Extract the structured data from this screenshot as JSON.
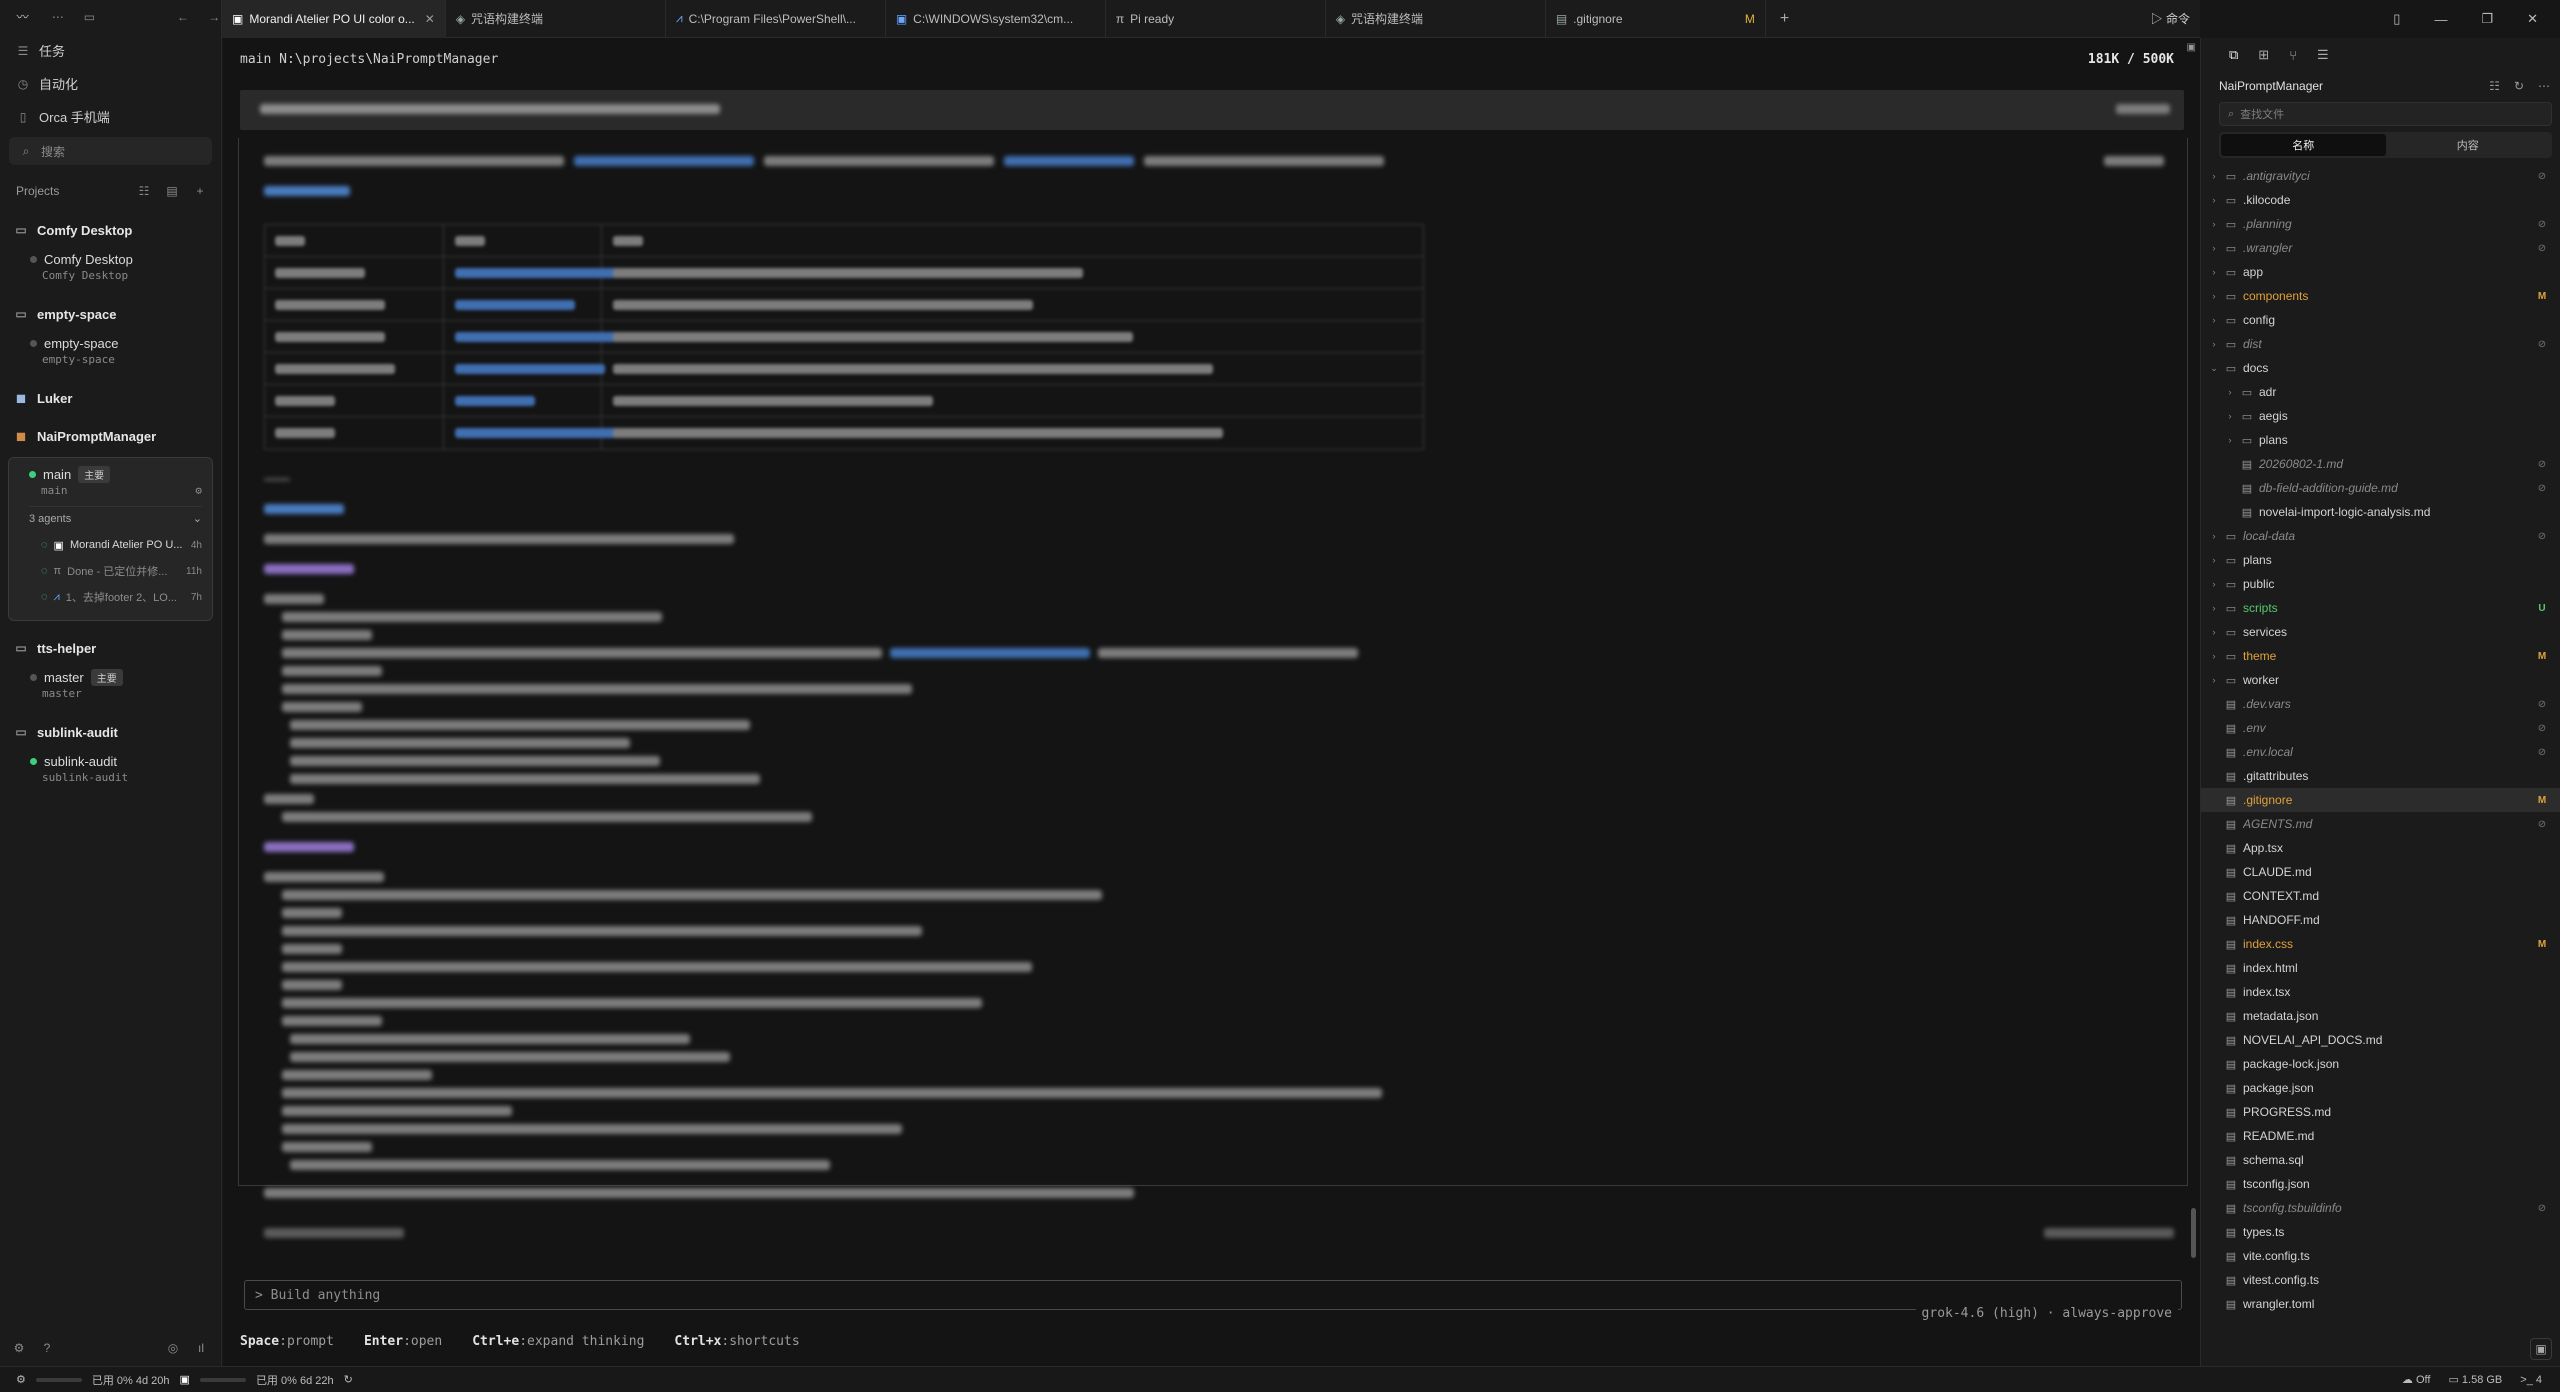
{
  "sidebar": {
    "nav": [
      {
        "label": "任务",
        "icon": "tasks-icon"
      },
      {
        "label": "自动化",
        "icon": "automation-icon"
      },
      {
        "label": "Orca 手机端",
        "icon": "phone-icon"
      }
    ],
    "search_placeholder": "搜索",
    "projects_label": "Projects",
    "groups": [
      {
        "name": "Comfy Desktop",
        "worktrees": [
          {
            "name": "Comfy Desktop",
            "branch": "Comfy Desktop"
          }
        ]
      },
      {
        "name": "empty-space",
        "worktrees": [
          {
            "name": "empty-space",
            "branch": "empty-space"
          }
        ]
      },
      {
        "name": "Luker",
        "worktrees": []
      },
      {
        "name": "NaiPromptManager",
        "worktrees": []
      },
      {
        "name": "tts-helper",
        "worktrees": [
          {
            "name": "master",
            "badge": "主要",
            "branch": "master"
          }
        ]
      },
      {
        "name": "sublink-audit",
        "worktrees": [
          {
            "name": "sublink-audit",
            "branch": "sublink-audit"
          }
        ]
      }
    ],
    "active_worktree": {
      "name": "main",
      "badge": "主要",
      "branch": "main",
      "agents_label": "3 agents",
      "agents": [
        {
          "title": "Morandi Atelier PO U...",
          "age": "4h"
        },
        {
          "title": "Done - 已定位并修...",
          "age": "11h"
        },
        {
          "title": "1、去掉footer 2、LO...",
          "age": "7h"
        }
      ]
    }
  },
  "tabs": [
    {
      "label": "Morandi Atelier PO UI color o..."
    },
    {
      "label": "咒语构建终端"
    },
    {
      "label": "C:\\Program Files\\PowerShell\\..."
    },
    {
      "label": "C:\\WINDOWS\\system32\\cm..."
    },
    {
      "label": "Pi ready"
    },
    {
      "label": "咒语构建终端"
    },
    {
      "label": ".gitignore",
      "status": "M"
    }
  ],
  "tab_run_label": "命令",
  "terminal": {
    "path": "main N:\\projects\\NaiPromptManager",
    "context": "181K / 500K",
    "input_placeholder": "> Build anything",
    "model": "grok-4.6 (high) · always-approve",
    "hints": [
      {
        "key": "Space",
        "action": ":prompt"
      },
      {
        "key": "Enter",
        "action": ":open"
      },
      {
        "key": "Ctrl+e",
        "action": ":expand thinking"
      },
      {
        "key": "Ctrl+x",
        "action": ":shortcuts"
      }
    ]
  },
  "files": {
    "title": "NaiPromptManager",
    "search_placeholder": "查找文件",
    "seg_name": "名称",
    "seg_content": "内容",
    "tree": [
      {
        "name": ".antigravityci",
        "kind": "folder",
        "depth": 0,
        "state": "ignored",
        "status": "o"
      },
      {
        "name": ".kilocode",
        "kind": "folder",
        "depth": 0,
        "state": "",
        "status": ""
      },
      {
        "name": ".planning",
        "kind": "folder",
        "depth": 0,
        "state": "ignored",
        "status": "o"
      },
      {
        "name": ".wrangler",
        "kind": "folder",
        "depth": 0,
        "state": "ignored",
        "status": "o"
      },
      {
        "name": "app",
        "kind": "folder",
        "depth": 0,
        "state": "",
        "status": ""
      },
      {
        "name": "components",
        "kind": "folder",
        "depth": 0,
        "state": "modified",
        "status": "M"
      },
      {
        "name": "config",
        "kind": "folder",
        "depth": 0,
        "state": "",
        "status": ""
      },
      {
        "name": "dist",
        "kind": "folder",
        "depth": 0,
        "state": "ignored",
        "status": "o"
      },
      {
        "name": "docs",
        "kind": "folder-open",
        "depth": 0,
        "state": "",
        "status": ""
      },
      {
        "name": "adr",
        "kind": "folder",
        "depth": 1,
        "state": "",
        "status": ""
      },
      {
        "name": "aegis",
        "kind": "folder",
        "depth": 1,
        "state": "",
        "status": ""
      },
      {
        "name": "plans",
        "kind": "folder",
        "depth": 1,
        "state": "",
        "status": ""
      },
      {
        "name": "20260802-1.md",
        "kind": "file",
        "depth": 1,
        "state": "ignored",
        "status": "o"
      },
      {
        "name": "db-field-addition-guide.md",
        "kind": "file",
        "depth": 1,
        "state": "ignored",
        "status": "o"
      },
      {
        "name": "novelai-import-logic-analysis.md",
        "kind": "file",
        "depth": 1,
        "state": "",
        "status": ""
      },
      {
        "name": "local-data",
        "kind": "folder",
        "depth": 0,
        "state": "ignored",
        "status": "o"
      },
      {
        "name": "plans",
        "kind": "folder",
        "depth": 0,
        "state": "",
        "status": ""
      },
      {
        "name": "public",
        "kind": "folder",
        "depth": 0,
        "state": "",
        "status": ""
      },
      {
        "name": "scripts",
        "kind": "folder",
        "depth": 0,
        "state": "new",
        "status": "U"
      },
      {
        "name": "services",
        "kind": "folder",
        "depth": 0,
        "state": "",
        "status": ""
      },
      {
        "name": "theme",
        "kind": "folder",
        "depth": 0,
        "state": "modified",
        "status": "M"
      },
      {
        "name": "worker",
        "kind": "folder",
        "depth": 0,
        "state": "",
        "status": ""
      },
      {
        "name": ".dev.vars",
        "kind": "file",
        "depth": 0,
        "state": "ignored",
        "status": "o"
      },
      {
        "name": ".env",
        "kind": "file",
        "depth": 0,
        "state": "ignored",
        "status": "o"
      },
      {
        "name": ".env.local",
        "kind": "file",
        "depth": 0,
        "state": "ignored",
        "status": "o"
      },
      {
        "name": ".gitattributes",
        "kind": "file",
        "depth": 0,
        "state": "",
        "status": ""
      },
      {
        "name": ".gitignore",
        "kind": "file",
        "depth": 0,
        "state": "modified",
        "status": "M",
        "selected": true
      },
      {
        "name": "AGENTS.md",
        "kind": "file",
        "depth": 0,
        "state": "ignored",
        "status": "o"
      },
      {
        "name": "App.tsx",
        "kind": "file",
        "depth": 0,
        "state": "",
        "status": ""
      },
      {
        "name": "CLAUDE.md",
        "kind": "file",
        "depth": 0,
        "state": "",
        "status": ""
      },
      {
        "name": "CONTEXT.md",
        "kind": "file",
        "depth": 0,
        "state": "",
        "status": ""
      },
      {
        "name": "HANDOFF.md",
        "kind": "file",
        "depth": 0,
        "state": "",
        "status": ""
      },
      {
        "name": "index.css",
        "kind": "file",
        "depth": 0,
        "state": "modified",
        "status": "M"
      },
      {
        "name": "index.html",
        "kind": "file",
        "depth": 0,
        "state": "",
        "status": ""
      },
      {
        "name": "index.tsx",
        "kind": "file",
        "depth": 0,
        "state": "",
        "status": ""
      },
      {
        "name": "metadata.json",
        "kind": "file",
        "depth": 0,
        "state": "",
        "status": ""
      },
      {
        "name": "NOVELAI_API_DOCS.md",
        "kind": "file",
        "depth": 0,
        "state": "",
        "status": ""
      },
      {
        "name": "package-lock.json",
        "kind": "file",
        "depth": 0,
        "state": "",
        "status": ""
      },
      {
        "name": "package.json",
        "kind": "file",
        "depth": 0,
        "state": "",
        "status": ""
      },
      {
        "name": "PROGRESS.md",
        "kind": "file",
        "depth": 0,
        "state": "",
        "status": ""
      },
      {
        "name": "README.md",
        "kind": "file",
        "depth": 0,
        "state": "",
        "status": ""
      },
      {
        "name": "schema.sql",
        "kind": "file",
        "depth": 0,
        "state": "",
        "status": ""
      },
      {
        "name": "tsconfig.json",
        "kind": "file",
        "depth": 0,
        "state": "",
        "status": ""
      },
      {
        "name": "tsconfig.tsbuildinfo",
        "kind": "file",
        "depth": 0,
        "state": "ignored",
        "status": "o"
      },
      {
        "name": "types.ts",
        "kind": "file",
        "depth": 0,
        "state": "",
        "status": ""
      },
      {
        "name": "vite.config.ts",
        "kind": "file",
        "depth": 0,
        "state": "",
        "status": ""
      },
      {
        "name": "vitest.config.ts",
        "kind": "file",
        "depth": 0,
        "state": "",
        "status": ""
      },
      {
        "name": "wrangler.toml",
        "kind": "file",
        "depth": 0,
        "state": "",
        "status": ""
      }
    ]
  },
  "status": {
    "usage1": "已用 0% 4d 20h",
    "usage2": "已用 0% 6d 22h",
    "usage1_fraction": 0.0,
    "usage2_fraction": 0.0,
    "sync": "Off",
    "memory": "1.58 GB",
    "terminals": "4"
  },
  "colors": {
    "accent_green": "#3ecf7a",
    "modified": "#e0a23a",
    "untracked": "#57c96a"
  }
}
